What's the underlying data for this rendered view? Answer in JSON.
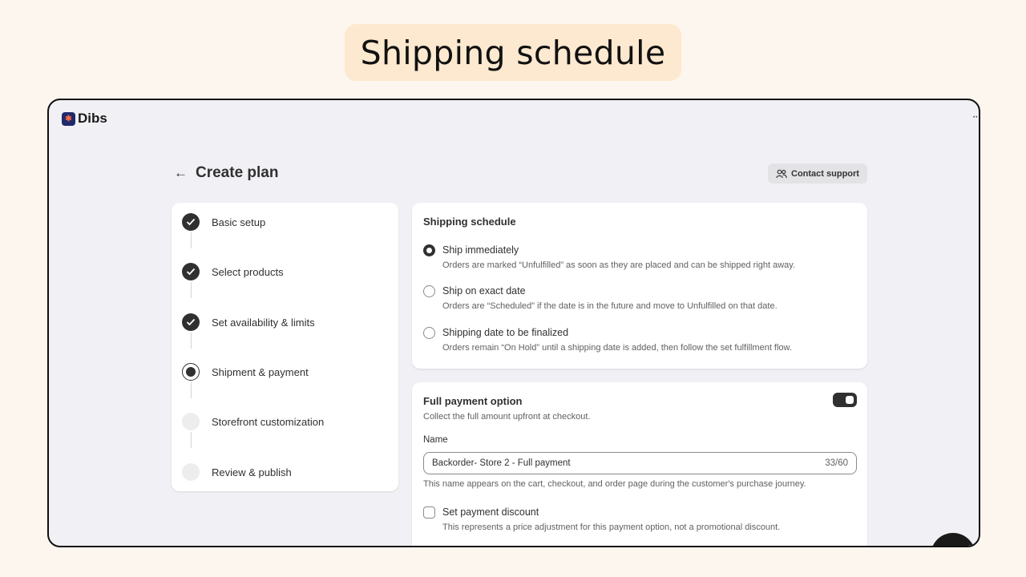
{
  "banner": {
    "title": "Shipping schedule"
  },
  "app": {
    "logo_text": "Dibs",
    "menu_icon": "ellipsis-icon"
  },
  "header": {
    "back_icon": "←",
    "title": "Create plan",
    "support_label": "Contact support"
  },
  "steps": [
    {
      "label": "Basic setup",
      "state": "done"
    },
    {
      "label": "Select products",
      "state": "done"
    },
    {
      "label": "Set availability & limits",
      "state": "done"
    },
    {
      "label": "Shipment & payment",
      "state": "current"
    },
    {
      "label": "Storefront customization",
      "state": "pending"
    },
    {
      "label": "Review & publish",
      "state": "pending"
    }
  ],
  "shipping": {
    "title": "Shipping schedule",
    "options": [
      {
        "label": "Ship immediately",
        "help": "Orders are marked “Unfulfilled” as soon as they are placed and can be shipped right away.",
        "checked": true
      },
      {
        "label": "Ship on exact date",
        "help": "Orders are “Scheduled” if the date is in the future and move to Unfulfilled on that date.",
        "checked": false
      },
      {
        "label": "Shipping date to be finalized",
        "help": "Orders remain “On Hold” until a shipping date is added, then follow the set fulfillment flow.",
        "checked": false
      }
    ]
  },
  "payment": {
    "title": "Full payment option",
    "subtitle": "Collect the full amount upfront at checkout.",
    "toggle_on": true,
    "name_label": "Name",
    "name_value": "Backorder- Store 2 - Full payment",
    "char_count": "33/60",
    "name_help": "This name appears on the cart, checkout, and order page during the customer's purchase journey.",
    "discount_label": "Set payment discount",
    "discount_help": "This represents a price adjustment for this payment option, not a promotional discount.",
    "discount_checked": false
  },
  "colors": {
    "accent": "#303030",
    "banner_bg": "#fde9cf",
    "page_bg": "#fdf6ef",
    "window_bg": "#f1f0f4",
    "logo_bg": "#1f2a6b"
  }
}
